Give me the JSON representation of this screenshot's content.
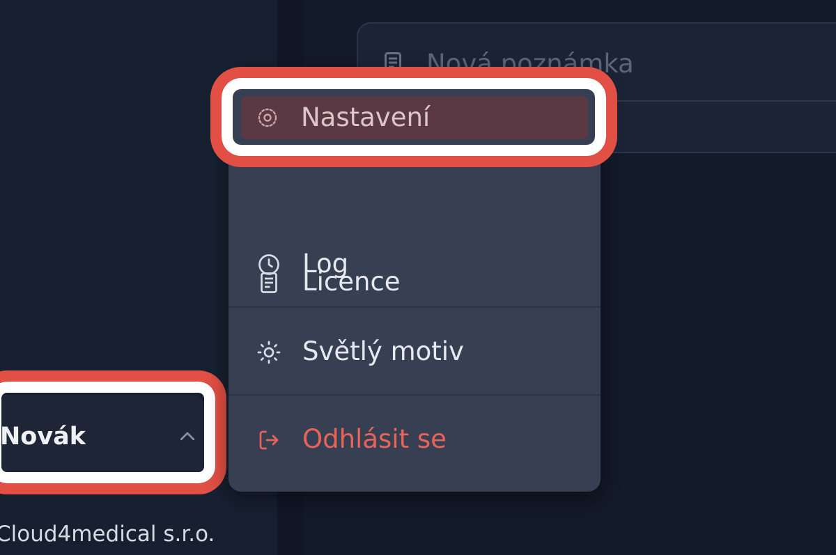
{
  "note": {
    "placeholder": "Nová poznámka"
  },
  "user": {
    "name": "Novák",
    "company": "Cloud4medical s.r.o."
  },
  "menu": {
    "items": [
      {
        "label": "Nastavení",
        "icon": "gear-icon"
      },
      {
        "label": "Licence",
        "icon": "document-icon"
      },
      {
        "label": "Log",
        "icon": "clock-icon"
      },
      {
        "label": "Světlý motiv",
        "icon": "sun-icon"
      },
      {
        "label": "Odhlásit se",
        "icon": "logout-icon"
      }
    ]
  },
  "colors": {
    "accent": "#e14f45",
    "danger_text": "#e8645a",
    "menu_bg": "#364052",
    "background": "#141a29"
  }
}
